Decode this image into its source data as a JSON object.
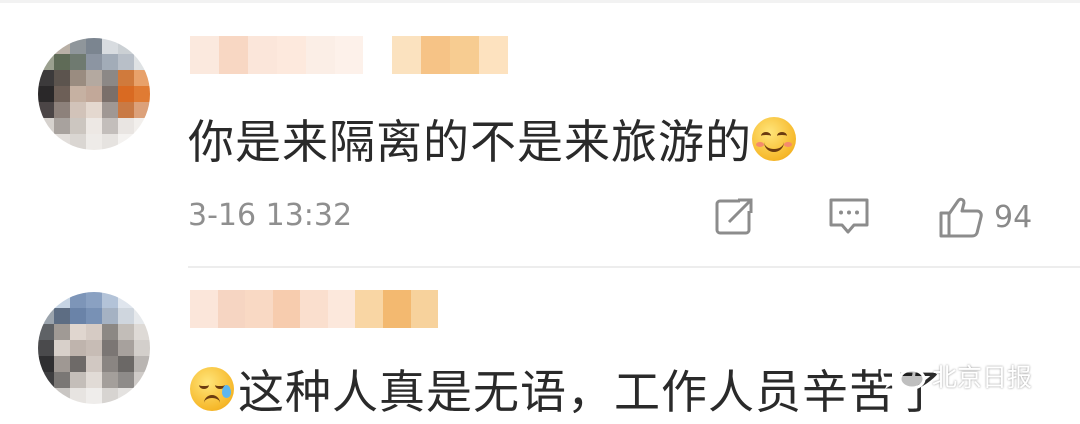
{
  "comments": [
    {
      "text": "你是来隔离的不是来旅游的",
      "emoji": "smiling-face-emoji",
      "timestamp": "3-16 13:32",
      "likes": "94"
    },
    {
      "text": "这种人真是无语，工作人员辛苦了",
      "emoji": "sweat-face-emoji"
    }
  ],
  "watermark": {
    "text": "北京日报",
    "icon": "wechat-icon"
  },
  "icons": {
    "share": "share-icon",
    "reply": "comment-icon",
    "like": "thumbs-up-icon"
  },
  "colors": {
    "text": "#2a2a2a",
    "meta": "#8f8f8f",
    "divider": "#ededed"
  }
}
